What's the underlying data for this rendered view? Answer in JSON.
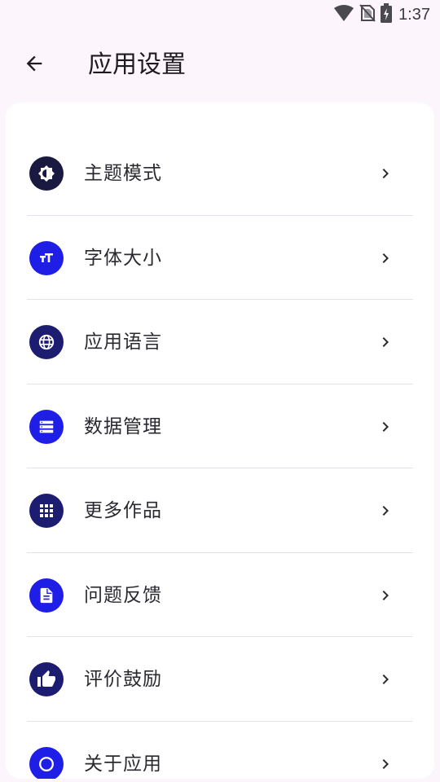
{
  "status_bar": {
    "time": "1:37",
    "icons": [
      "wifi-icon",
      "no-sim-icon",
      "battery-charging-icon"
    ]
  },
  "header": {
    "back_icon": "arrow-left-icon",
    "title": "应用设置"
  },
  "settings": {
    "items": [
      {
        "label": "主题模式",
        "icon": "theme-mode-icon",
        "color": "#1A1A40"
      },
      {
        "label": "字体大小",
        "icon": "text-size-icon",
        "color": "#1E1EE6"
      },
      {
        "label": "应用语言",
        "icon": "globe-icon",
        "color": "#1C1C70"
      },
      {
        "label": "数据管理",
        "icon": "storage-list-icon",
        "color": "#1E1EE6"
      },
      {
        "label": "更多作品",
        "icon": "apps-grid-icon",
        "color": "#1C1C70"
      },
      {
        "label": "问题反馈",
        "icon": "feedback-document-icon",
        "color": "#1E1EE6"
      },
      {
        "label": "评价鼓励",
        "icon": "thumb-up-icon",
        "color": "#1C1C70"
      },
      {
        "label": "关于应用",
        "icon": "about-circle-icon",
        "color": "#1E1EE6"
      }
    ],
    "chevron_icon": "chevron-right-icon"
  }
}
